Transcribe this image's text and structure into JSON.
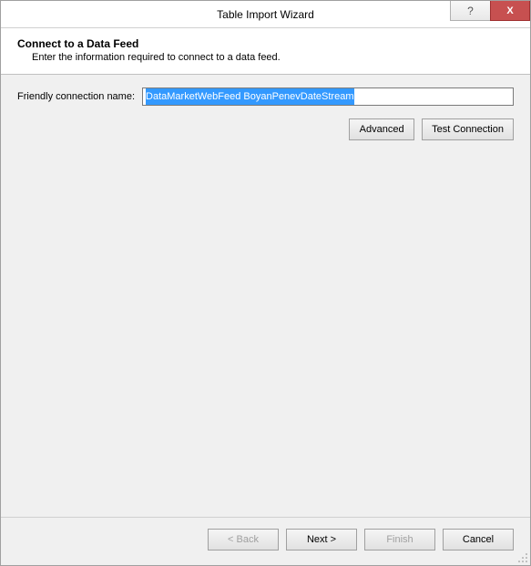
{
  "window": {
    "title": "Table Import Wizard",
    "help_symbol": "?",
    "close_symbol": "X"
  },
  "header": {
    "title": "Connect to a Data Feed",
    "subtitle": "Enter the information required to connect to a data feed."
  },
  "form": {
    "friendly_name_label": "Friendly connection name:",
    "friendly_name_value": "DataMarketWebFeed BoyanPenevDateStream"
  },
  "buttons": {
    "advanced": "Advanced",
    "test_connection": "Test Connection",
    "back": "< Back",
    "next": "Next >",
    "finish": "Finish",
    "cancel": "Cancel"
  }
}
